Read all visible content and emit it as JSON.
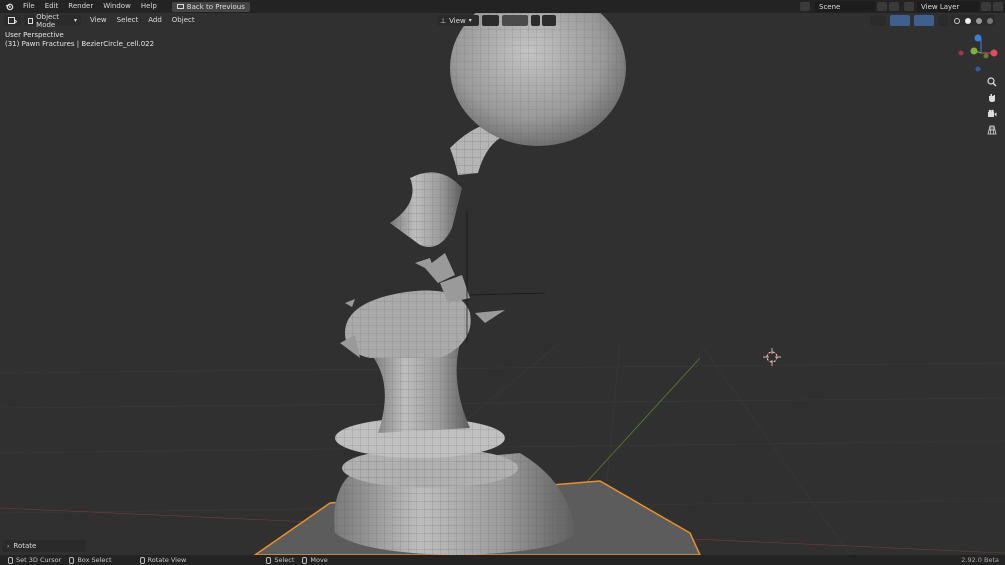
{
  "topbar": {
    "menus": [
      "File",
      "Edit",
      "Render",
      "Window",
      "Help"
    ],
    "back_label": "Back to Previous",
    "scene": "Scene",
    "view_layer": "View Layer"
  },
  "viewport_header": {
    "mode": "Object Mode",
    "menus": [
      "View",
      "Select",
      "Add",
      "Object"
    ],
    "view_label": "View"
  },
  "overlay": {
    "perspective": "User Perspective",
    "object_info": "(31) Pawn Fractures | BezierCircle_cell.022"
  },
  "gizmo": {
    "colors": {
      "x": "#e04a5f",
      "y": "#7db03d",
      "z": "#3b7fd9"
    },
    "labels": {
      "x": "X",
      "y": "Y",
      "z": "Z"
    }
  },
  "nav_icons": [
    "zoom-icon",
    "pan-hand-icon",
    "camera-icon",
    "grid-icon"
  ],
  "rotate_panel": {
    "label": "Rotate"
  },
  "statusbar": {
    "items": [
      "Set 3D Cursor",
      "Box Select",
      "Rotate View",
      "Select",
      "Move"
    ],
    "version": "2.92.0 Beta"
  },
  "colors": {
    "background": "#303030",
    "menubar": "#232323",
    "selection": "#e8902c"
  }
}
